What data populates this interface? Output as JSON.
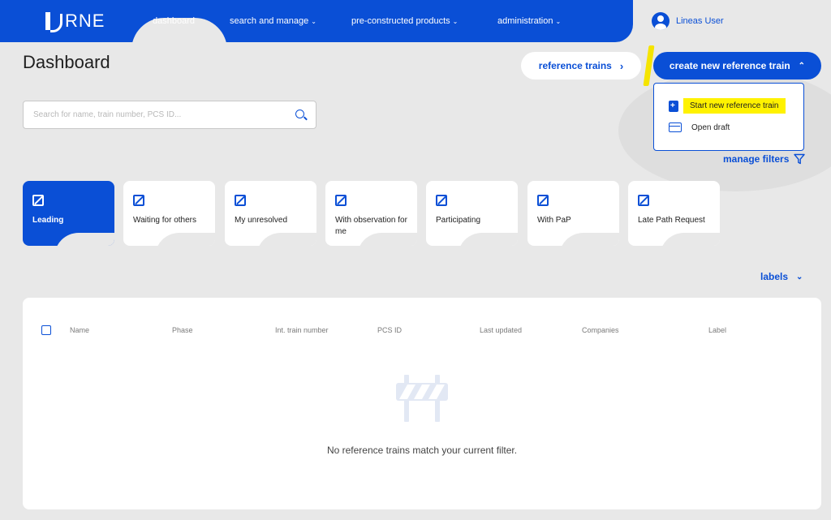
{
  "nav": {
    "logo": "RNE",
    "items": [
      {
        "label": "dashboard"
      },
      {
        "label": "search and manage"
      },
      {
        "label": "pre-constructed products"
      },
      {
        "label": "administration"
      }
    ],
    "user": "Lineas User"
  },
  "header": {
    "title": "Dashboard",
    "ref_trains_label": "reference trains",
    "create_label": "create new reference train"
  },
  "dropdown": {
    "items": [
      {
        "label": "Start new reference train",
        "icon": "new-document-icon"
      },
      {
        "label": "Open draft",
        "icon": "draft-icon"
      }
    ]
  },
  "search": {
    "placeholder": "Search for name, train number, PCS ID...",
    "value": ""
  },
  "filters": {
    "manage_label": "manage filters",
    "cards": [
      {
        "label": "Leading",
        "active": true
      },
      {
        "label": "Waiting for others",
        "active": false
      },
      {
        "label": "My unresolved",
        "active": false
      },
      {
        "label": "With observation for me",
        "active": false
      },
      {
        "label": "Participating",
        "active": false
      },
      {
        "label": "With PaP",
        "active": false
      },
      {
        "label": "Late Path Request",
        "active": false
      }
    ]
  },
  "labels_toggle": "labels",
  "table": {
    "columns": [
      "Name",
      "Phase",
      "Int. train number",
      "PCS ID",
      "Last updated",
      "Companies",
      "Label"
    ],
    "empty_message": "No reference trains match your current filter."
  },
  "colors": {
    "primary": "#0a4fd6",
    "background": "#e8e8e8",
    "highlight": "#fff200"
  }
}
